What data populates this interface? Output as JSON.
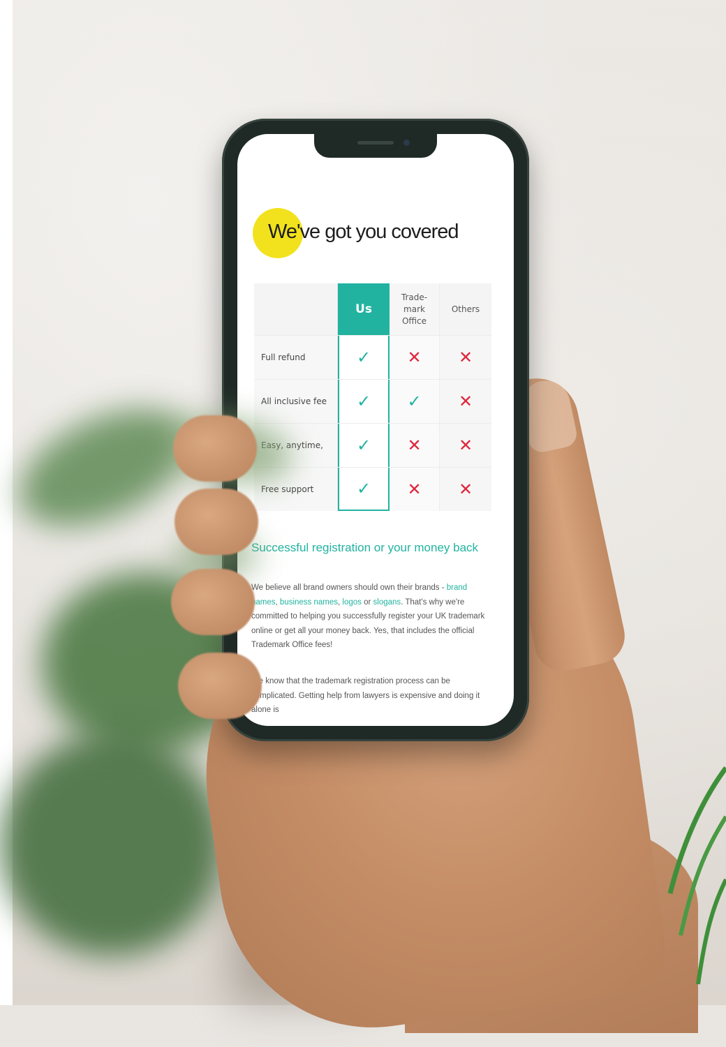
{
  "screen": {
    "headline": "We've got you covered",
    "table": {
      "columns": [
        "Us",
        "Trade-mark Office",
        "Others"
      ],
      "rows": [
        {
          "label": "Full refund",
          "values": [
            "check",
            "cross",
            "cross"
          ]
        },
        {
          "label": "All inclusive fee",
          "values": [
            "check",
            "check",
            "cross"
          ]
        },
        {
          "label": "Easy, anytime,",
          "values": [
            "check",
            "cross",
            "cross"
          ]
        },
        {
          "label": "Free support",
          "values": [
            "check",
            "cross",
            "cross"
          ]
        }
      ]
    },
    "sub_heading": "Successful registration or your money back",
    "paragraph1": {
      "part1": "We believe all brand owners should own their brands - ",
      "link1": "brand names",
      "sep1": ", ",
      "link2": "business names",
      "sep2": ", ",
      "link3": "logos",
      "sep3": " or ",
      "link4": "slogans",
      "part2": ". That's why we're committed to helping you successfully register your UK trademark online or get all your money back. Yes, that includes the official Trademark Office fees!"
    },
    "paragraph2": "We know that the trademark registration process can be complicated. Getting help from lawyers is expensive and doing it alone is"
  },
  "colors": {
    "accent": "#21b3a0",
    "highlight": "#f2e21d",
    "cross": "#e0243a"
  }
}
